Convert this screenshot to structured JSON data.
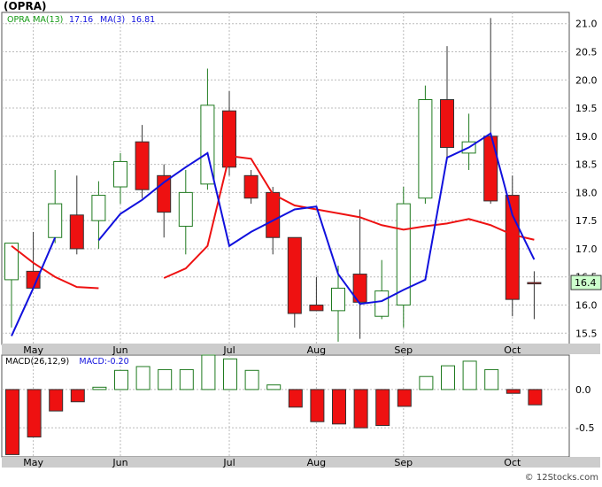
{
  "symbol": "(OPRA)",
  "watermark": "© 12Stocks.com",
  "colors": {
    "up": "#1f7a1f",
    "down": "#ee1111",
    "ma13": "#ee1111",
    "ma3": "#1111dd",
    "label_green": "#119911",
    "label_blue": "#1111dd",
    "last_price_bg": "#ccffcc",
    "grid": "#bbbbbb",
    "axis_bg": "#cccccc"
  },
  "price_panel": {
    "legend": [
      {
        "text": "OPRA",
        "color": "green"
      },
      {
        "text": "MA(13)",
        "color": "green"
      },
      {
        "text": "17.16",
        "color": "blue"
      },
      {
        "text": "MA(3)",
        "color": "blue"
      },
      {
        "text": "16.81",
        "color": "blue"
      }
    ],
    "last_price_label": "16.4"
  },
  "macd_panel": {
    "legend": [
      {
        "text": "MACD(26,12,9)",
        "color": "black"
      },
      {
        "text": "MACD:-0.20",
        "color": "blue"
      }
    ]
  },
  "chart_data": [
    {
      "type": "candlestick",
      "title": "(OPRA)",
      "x_ticks": [
        "May",
        "Jun",
        "Jul",
        "Aug",
        "Sep",
        "Oct"
      ],
      "x_tick_index": [
        1,
        5,
        10,
        14,
        18,
        23
      ],
      "y_ticks": [
        15.5,
        16.0,
        16.5,
        17.0,
        17.5,
        18.0,
        18.5,
        19.0,
        19.5,
        20.0,
        20.5,
        21.0
      ],
      "ylim": [
        15.3,
        21.2
      ],
      "candles": [
        {
          "open": 16.45,
          "high": 17.1,
          "low": 15.6,
          "close": 17.1
        },
        {
          "open": 16.6,
          "high": 17.3,
          "low": 16.5,
          "close": 16.3
        },
        {
          "open": 17.2,
          "high": 18.4,
          "low": 17.1,
          "close": 17.8
        },
        {
          "open": 17.6,
          "high": 18.3,
          "low": 16.9,
          "close": 17.0
        },
        {
          "open": 17.5,
          "high": 18.2,
          "low": 17.0,
          "close": 17.95
        },
        {
          "open": 18.1,
          "high": 18.7,
          "low": 17.8,
          "close": 18.55
        },
        {
          "open": 18.9,
          "high": 19.2,
          "low": 17.9,
          "close": 18.05
        },
        {
          "open": 18.3,
          "high": 18.5,
          "low": 17.2,
          "close": 17.65
        },
        {
          "open": 17.4,
          "high": 18.4,
          "low": 16.9,
          "close": 18.0
        },
        {
          "open": 18.15,
          "high": 20.2,
          "low": 18.05,
          "close": 19.55
        },
        {
          "open": 19.45,
          "high": 19.8,
          "low": 18.3,
          "close": 18.45
        },
        {
          "open": 18.3,
          "high": 18.4,
          "low": 17.8,
          "close": 17.9
        },
        {
          "open": 18.0,
          "high": 18.1,
          "low": 16.9,
          "close": 17.2
        },
        {
          "open": 17.2,
          "high": 17.2,
          "low": 15.6,
          "close": 15.85
        },
        {
          "open": 16.0,
          "high": 16.5,
          "low": 15.9,
          "close": 15.9
        },
        {
          "open": 15.9,
          "high": 16.7,
          "low": 15.35,
          "close": 16.3
        },
        {
          "open": 16.55,
          "high": 17.7,
          "low": 15.4,
          "close": 16.05
        },
        {
          "open": 15.8,
          "high": 16.8,
          "low": 15.75,
          "close": 16.25
        },
        {
          "open": 16.0,
          "high": 18.1,
          "low": 15.6,
          "close": 17.8
        },
        {
          "open": 17.9,
          "high": 19.9,
          "low": 17.8,
          "close": 19.65
        },
        {
          "open": 19.65,
          "high": 20.6,
          "low": 18.6,
          "close": 18.8
        },
        {
          "open": 18.7,
          "high": 19.4,
          "low": 18.4,
          "close": 18.9
        },
        {
          "open": 19.0,
          "high": 21.1,
          "low": 17.8,
          "close": 17.85
        },
        {
          "open": 17.95,
          "high": 18.3,
          "low": 15.8,
          "close": 16.1
        },
        {
          "open": 16.4,
          "high": 16.6,
          "low": 15.75,
          "close": 16.38
        }
      ],
      "series": [
        {
          "name": "MA(13)",
          "color": "red",
          "values": [
            17.05,
            16.75,
            16.5,
            16.32,
            16.3,
            null,
            null,
            16.48,
            16.65,
            17.05,
            18.65,
            18.6,
            17.97,
            17.77,
            17.7,
            17.63,
            17.56,
            17.42,
            17.34,
            17.4,
            17.45,
            17.53,
            17.42,
            17.25,
            17.16
          ]
        },
        {
          "name": "MA(3)",
          "color": "blue",
          "values": [
            15.45,
            16.3,
            17.2,
            null,
            17.15,
            17.62,
            17.87,
            18.18,
            18.45,
            18.7,
            17.05,
            17.3,
            17.5,
            17.7,
            17.75,
            16.55,
            16.02,
            16.07,
            16.27,
            16.45,
            18.62,
            18.8,
            19.05,
            17.6,
            16.81
          ]
        }
      ],
      "legend_position": "top-left",
      "grid": true
    },
    {
      "type": "bar",
      "title": "MACD(26,12,9)",
      "x_ticks": [
        "May",
        "Jun",
        "Jul",
        "Aug",
        "Sep",
        "Oct"
      ],
      "x_tick_index": [
        1,
        5,
        10,
        14,
        18,
        23
      ],
      "y_ticks": [
        0.0,
        -0.5
      ],
      "ylim": [
        -0.88,
        0.45
      ],
      "values": [
        -0.85,
        -0.62,
        -0.28,
        -0.16,
        0.03,
        0.25,
        0.3,
        0.26,
        0.26,
        0.45,
        0.4,
        0.25,
        0.06,
        -0.23,
        -0.42,
        -0.45,
        -0.5,
        -0.47,
        -0.22,
        0.17,
        0.31,
        0.37,
        0.26,
        -0.05,
        -0.2
      ],
      "grid": true
    }
  ]
}
